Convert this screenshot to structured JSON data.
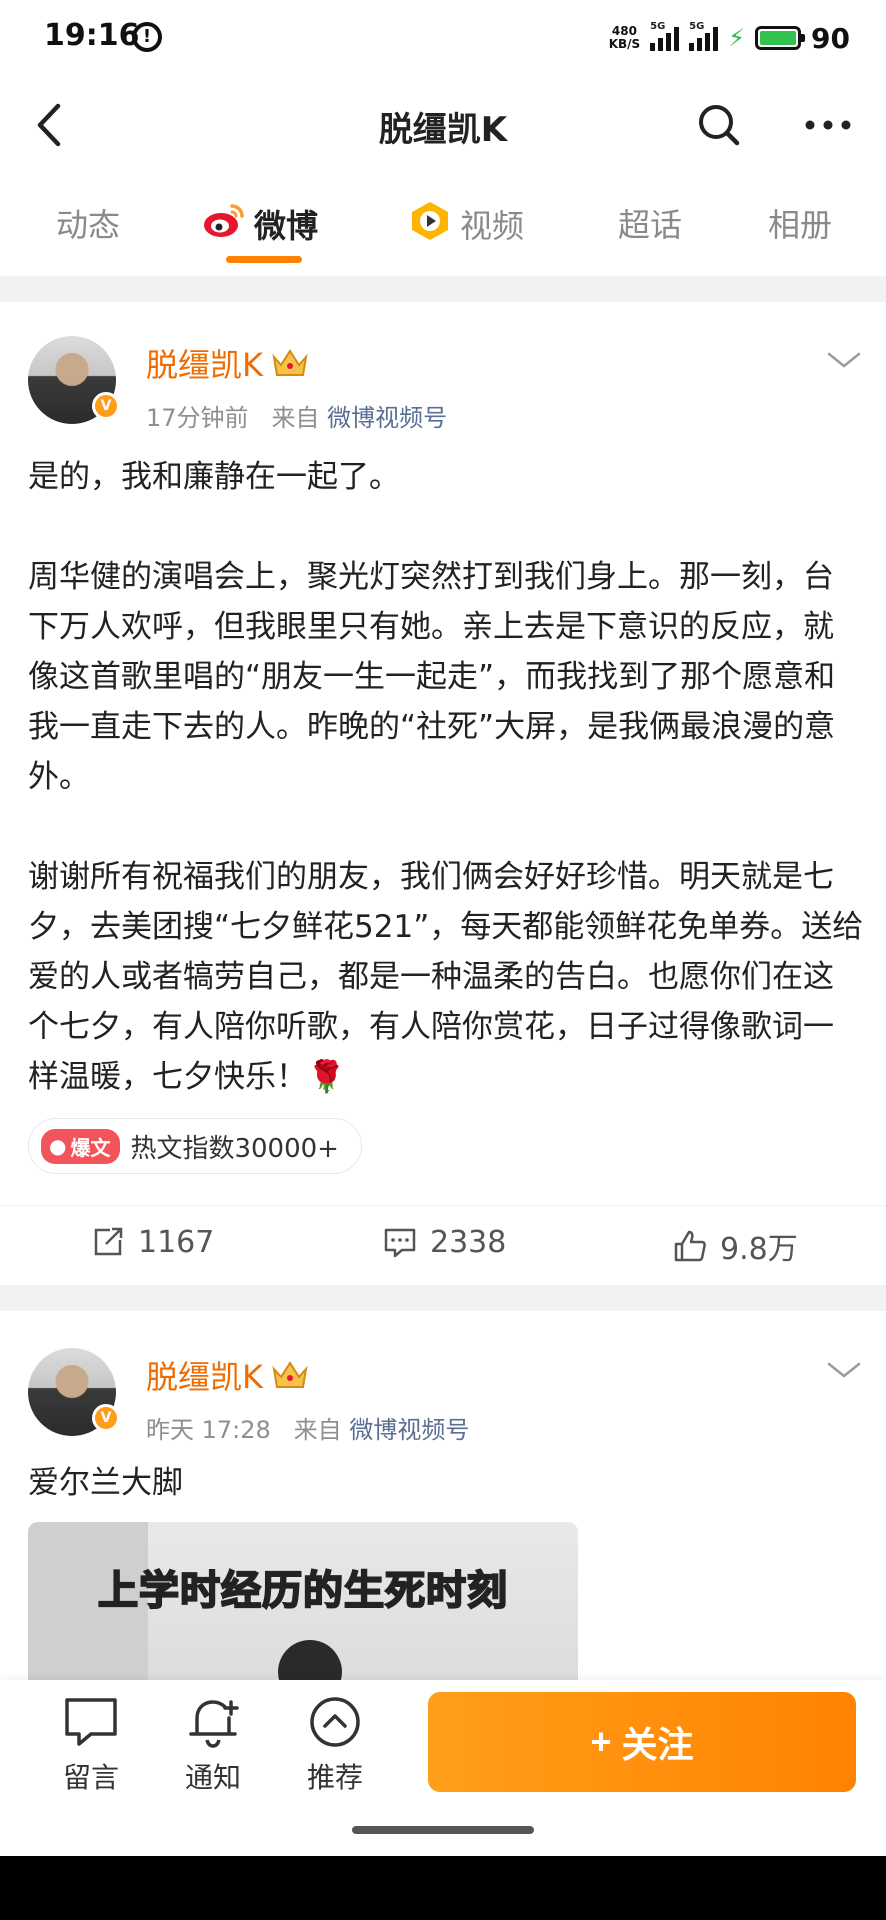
{
  "status_bar": {
    "time": "19:16",
    "net_speed": "480",
    "net_speed_unit": "KB/S",
    "signal1_label": "5G",
    "signal2_label": "5G",
    "battery": "90",
    "battery_color": "#33c24d"
  },
  "header": {
    "title": "脱缰凯K",
    "icons": [
      "back-icon",
      "search-icon",
      "more-icon"
    ]
  },
  "tabs": [
    {
      "label": "动态",
      "active": false
    },
    {
      "label": "微博",
      "active": true
    },
    {
      "label": "视频",
      "active": false
    },
    {
      "label": "超话",
      "active": false
    },
    {
      "label": "相册",
      "active": false
    }
  ],
  "accent_color": "#ff8200",
  "posts": [
    {
      "author": "脱缰凯K",
      "time": "17分钟前",
      "source_prefix": "来自",
      "source": "微博视频号",
      "paragraphs": [
        "是的，我和廉静在一起了。",
        "周华健的演唱会上，聚光灯突然打到我们身上。那一刻，台下万人欢呼，但我眼里只有她。亲上去是下意识的反应，就像这首歌里唱的“朋友一生一起走”，而我找到了那个愿意和我一直走下去的人。昨晚的“社死”大屏，是我俩最浪漫的意外。",
        "谢谢所有祝福我们的朋友，我们俩会好好珍惜。明天就是七夕，去美团搜“七夕鲜花521”，每天都能领鲜花免单券。送给爱的人或者犒劳自己，都是一种温柔的告白。也愿你们在这个七夕，有人陪你听歌，有人陪你赏花，日子过得像歌词一样温暖，七夕快乐！🌹"
      ],
      "hot_tag": "爆文",
      "hot_text": "热文指数30000+",
      "reposts": "1167",
      "comments": "2338",
      "likes": "9.8万"
    },
    {
      "author": "脱缰凯K",
      "time": "昨天 17:28",
      "source_prefix": "来自",
      "source": "微博视频号",
      "text": "爱尔兰大脚",
      "video_caption": "上学时经历的生死时刻"
    }
  ],
  "bottom_bar": {
    "message": "留言",
    "notify": "通知",
    "recommend": "推荐",
    "follow": "关注",
    "follow_prefix": "+"
  }
}
